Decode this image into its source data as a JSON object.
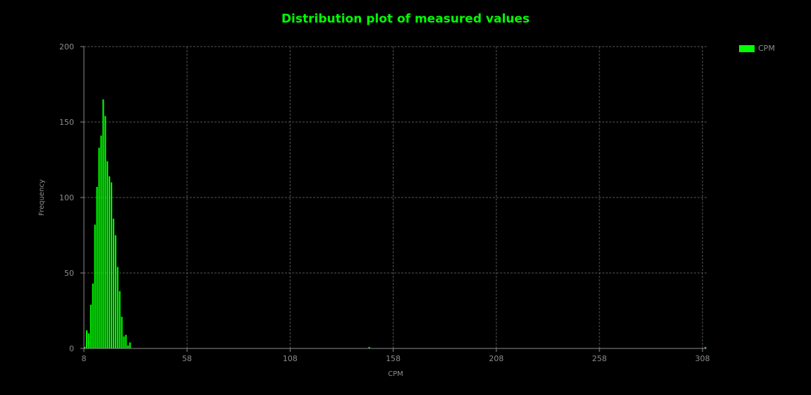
{
  "chart_data": {
    "type": "bar",
    "title": "Distribution plot of measured values",
    "xlabel": "CPM",
    "ylabel": "Frequency",
    "xlim": [
      8,
      310
    ],
    "ylim": [
      0,
      200
    ],
    "xticks": [
      8,
      58,
      108,
      158,
      208,
      258,
      308
    ],
    "yticks": [
      0,
      50,
      100,
      150,
      200
    ],
    "grid": true,
    "legend_position": "top-right",
    "series": [
      {
        "name": "CPM",
        "color": "#00ff00",
        "x": [
          8,
          9,
          10,
          11,
          12,
          13,
          14,
          15,
          16,
          17,
          18,
          19,
          20,
          21,
          22,
          23,
          24,
          25,
          26,
          27,
          28,
          29,
          30,
          31,
          146,
          309
        ],
        "values": [
          1,
          12,
          10,
          29,
          43,
          82,
          107,
          133,
          141,
          165,
          154,
          124,
          114,
          110,
          86,
          75,
          54,
          38,
          21,
          8,
          9,
          2,
          4,
          0,
          1,
          1
        ]
      }
    ]
  }
}
